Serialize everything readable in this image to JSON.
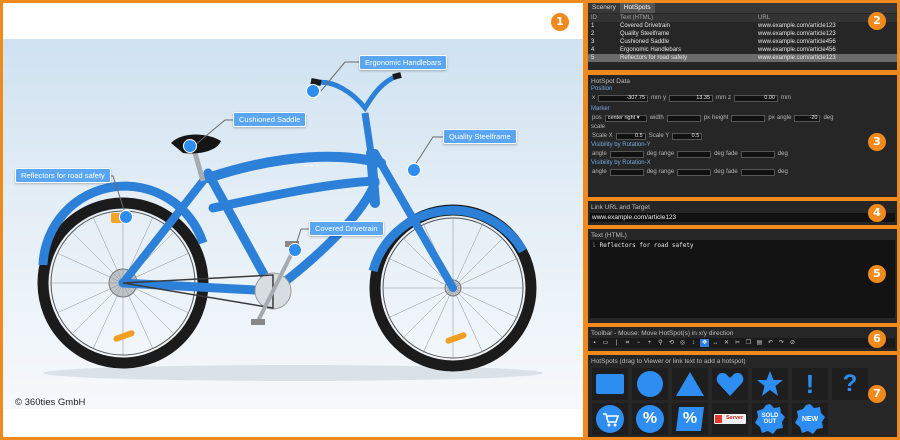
{
  "viewer": {
    "copyright": "© 360ties GmbH",
    "hotspots": [
      {
        "label": "Ergonomic Handlebars"
      },
      {
        "label": "Cushioned Saddle"
      },
      {
        "label": "Quality Steelframe"
      },
      {
        "label": "Reflectors for road safety"
      },
      {
        "label": "Covered Drivetrain"
      }
    ]
  },
  "badges": [
    "1",
    "2",
    "3",
    "4",
    "5",
    "6",
    "7"
  ],
  "list_panel": {
    "tabs": [
      "Scenery",
      "HotSpots"
    ],
    "active_tab": "HotSpots",
    "columns": [
      "ID",
      "Text (HTML)",
      "URL"
    ],
    "rows": [
      {
        "id": "1",
        "text": "Covered Drivetrain",
        "url": "www.example.com/article123"
      },
      {
        "id": "2",
        "text": "Quality Steelframe",
        "url": "www.example.com/article123"
      },
      {
        "id": "3",
        "text": "Cushioned Saddle",
        "url": "www.example.com/article456"
      },
      {
        "id": "4",
        "text": "Ergonomic Handlebars",
        "url": "www.example.com/article456"
      },
      {
        "id": "5",
        "text": "Reflectors for road safety",
        "url": "www.example.com/article123"
      }
    ],
    "selected_row": 4
  },
  "hotspot_data": {
    "title": "HotSpot Data",
    "position_label": "Position",
    "x_label": "x",
    "x_value": "-307.75",
    "y_label": "y",
    "y_value": "13.35",
    "z_label": "z",
    "z_value": "0.00",
    "unit_mm": "mm",
    "marker_label": "Marker",
    "pos_label": "pos",
    "pos_value": "center right",
    "width_label": "width",
    "height_label": "height",
    "angle_label": "angle",
    "angle_value": "-20",
    "unit_px": "px",
    "unit_deg": "deg",
    "scale_label": "scale",
    "scalex_label": "Scale X",
    "scalex_value": "0.5",
    "scaley_label": "Scale Y",
    "scaley_value": "0.5",
    "vis_y_label": "Visibility by Rotation-Y",
    "vis_x_label": "Visibility by Rotation-X",
    "range_label": "range",
    "fade_label": "fade"
  },
  "link_panel": {
    "title": "Link URL and Target",
    "value": "www.example.com/article123"
  },
  "text_panel": {
    "title": "Text (HTML)",
    "line_no": "1",
    "value": "Reflectors for road safety"
  },
  "toolbar_panel": {
    "title": "Toolbar - Mouse: Move HotSpot(s) in x/y direction"
  },
  "icons_panel": {
    "title": "HotSpots (drag to Viewer or link text to add a hotspot)",
    "icons": [
      {
        "name": "square",
        "text": ""
      },
      {
        "name": "circle",
        "text": ""
      },
      {
        "name": "triangle",
        "text": ""
      },
      {
        "name": "heart",
        "text": ""
      },
      {
        "name": "star",
        "text": ""
      },
      {
        "name": "exclamation",
        "text": "!"
      },
      {
        "name": "question",
        "text": "?"
      },
      {
        "name": "cart",
        "text": ""
      },
      {
        "name": "percent-circle",
        "text": "%"
      },
      {
        "name": "percent-square",
        "text": "%"
      },
      {
        "name": "server-logo",
        "text": "Server"
      },
      {
        "name": "sold-out",
        "text": "SOLD OUT"
      },
      {
        "name": "new-badge",
        "text": "NEW"
      }
    ]
  },
  "colors": {
    "accent": "#f08a1c",
    "bike_blue": "#2d80d8",
    "hotspot_blue": "#5aa6f2",
    "icon_blue": "#2d8df0",
    "panel_bg": "#262626"
  }
}
